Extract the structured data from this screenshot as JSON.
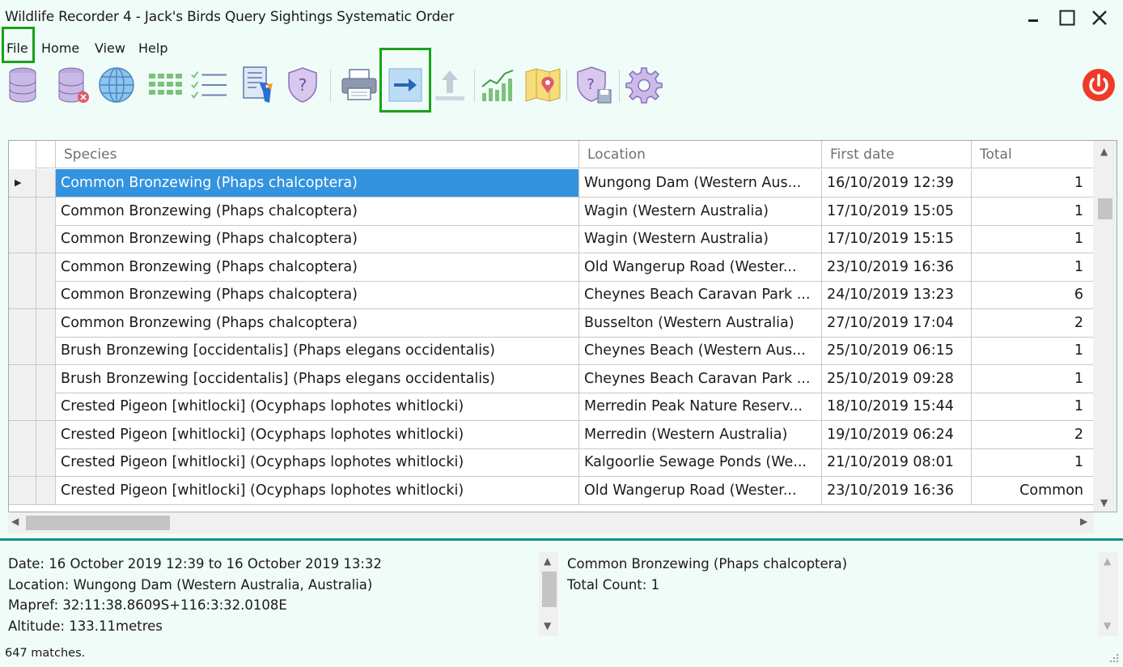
{
  "window": {
    "title": "Wildlife Recorder 4 - Jack's Birds  Query Sightings Systematic Order"
  },
  "menu": [
    "File",
    "Home",
    "View",
    "Help"
  ],
  "toolbar": {
    "buttons": [
      "database-icon",
      "database-delete-icon",
      "globe-icon",
      "grid-icon",
      "checklist-icon",
      "bird-document-icon",
      "shield-help-icon",
      "print-icon",
      "export-arrow-icon",
      "upload-icon",
      "chart-icon",
      "map-pin-icon",
      "shield-save-icon",
      "settings-gear-icon",
      "power-icon"
    ]
  },
  "grid": {
    "columns": [
      "Species",
      "Location",
      "First date",
      "Total"
    ],
    "rows": [
      {
        "species": "Common Bronzewing (Phaps chalcoptera)",
        "location": "Wungong Dam (Western Aus...",
        "date": "16/10/2019 12:39",
        "total": "1"
      },
      {
        "species": "Common Bronzewing (Phaps chalcoptera)",
        "location": "Wagin (Western Australia)",
        "date": "17/10/2019 15:05",
        "total": "1"
      },
      {
        "species": "Common Bronzewing (Phaps chalcoptera)",
        "location": "Wagin (Western Australia)",
        "date": "17/10/2019 15:15",
        "total": "1"
      },
      {
        "species": "Common Bronzewing (Phaps chalcoptera)",
        "location": "Old Wangerup Road (Wester...",
        "date": "23/10/2019 16:36",
        "total": "1"
      },
      {
        "species": "Common Bronzewing (Phaps chalcoptera)",
        "location": "Cheynes Beach Caravan Park ...",
        "date": "24/10/2019 13:23",
        "total": "6"
      },
      {
        "species": "Common Bronzewing (Phaps chalcoptera)",
        "location": "Busselton (Western Australia)",
        "date": "27/10/2019 17:04",
        "total": "2"
      },
      {
        "species": "Brush Bronzewing [occidentalis] (Phaps elegans occidentalis)",
        "location": "Cheynes Beach (Western Aus...",
        "date": "25/10/2019 06:15",
        "total": "1"
      },
      {
        "species": "Brush Bronzewing [occidentalis] (Phaps elegans occidentalis)",
        "location": "Cheynes Beach Caravan Park ...",
        "date": "25/10/2019 09:28",
        "total": "1"
      },
      {
        "species": "Crested Pigeon [whitlocki] (Ocyphaps lophotes whitlocki)",
        "location": "Merredin Peak Nature Reserv...",
        "date": "18/10/2019 15:44",
        "total": "1"
      },
      {
        "species": "Crested Pigeon [whitlocki] (Ocyphaps lophotes whitlocki)",
        "location": "Merredin (Western Australia)",
        "date": "19/10/2019 06:24",
        "total": "2"
      },
      {
        "species": "Crested Pigeon [whitlocki] (Ocyphaps lophotes whitlocki)",
        "location": "Kalgoorlie Sewage Ponds (We...",
        "date": "21/10/2019 08:01",
        "total": "1"
      },
      {
        "species": "Crested Pigeon [whitlocki] (Ocyphaps lophotes whitlocki)",
        "location": "Old Wangerup Road (Wester...",
        "date": "23/10/2019 16:36",
        "total": "Common"
      }
    ]
  },
  "detail": {
    "date": "Date: 16 October 2019 12:39 to 16 October 2019 13:32",
    "location": "Location: Wungong Dam (Western Australia, Australia)",
    "mapref": "Mapref: 32:11:38.8609S+116:3:32.0108E",
    "altitude": "Altitude: 133.11metres",
    "species": "Common Bronzewing (Phaps chalcoptera)",
    "count": "Total Count: 1"
  },
  "status": "647 matches.",
  "colors": {
    "selection": "#3393df",
    "highlight": "#1aa11a",
    "accent": "#16908a"
  }
}
